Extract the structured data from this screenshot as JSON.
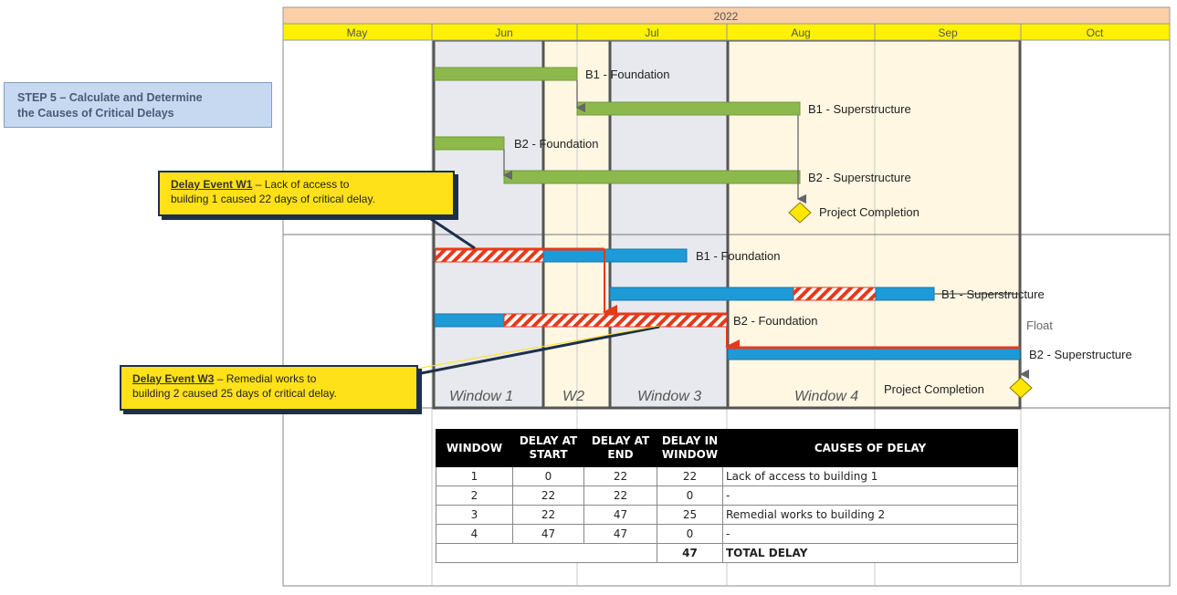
{
  "timeline": {
    "year": "2022",
    "months": [
      "May",
      "Jun",
      "Jul",
      "Aug",
      "Sep",
      "Oct"
    ]
  },
  "step_box": {
    "line1": "STEP 5 – Calculate and Determine",
    "line2": "the Causes of Critical Delays"
  },
  "planned_activities": {
    "b1_foundation": "B1 - Foundation",
    "b1_superstructure": "B1 - Superstructure",
    "b2_foundation": "B2 - Foundation",
    "b2_superstructure": "B2 - Superstructure",
    "completion": "Project Completion"
  },
  "asbuilt_activities": {
    "b1_foundation": "B1 - Foundation",
    "b1_superstructure": "B1 - Superstructure",
    "b2_foundation": "B2 - Foundation",
    "b2_superstructure": "B2 - Superstructure",
    "float": "Float",
    "completion": "Project Completion"
  },
  "windows": [
    "Window 1",
    "W2",
    "Window 3",
    "Window 4"
  ],
  "callouts": {
    "w1": {
      "event": "Delay Event W1",
      "text1": " – Lack of access to",
      "text2": "building 1 caused 22 days of critical delay."
    },
    "w3": {
      "event": "Delay Event W3",
      "text1": " – Remedial works to",
      "text2": "building 2 caused 25 days of critical delay."
    }
  },
  "delay_table": {
    "headers": {
      "window": "WINDOW",
      "start_1": "DELAY AT",
      "start_2": "START",
      "end_1": "DELAY AT",
      "end_2": "END",
      "in_1": "DELAY IN",
      "in_2": "WINDOW",
      "causes": "CAUSES OF DELAY"
    },
    "rows": [
      {
        "window": "1",
        "start": "0",
        "end": "22",
        "in_window": "22",
        "cause": "Lack of access to building 1"
      },
      {
        "window": "2",
        "start": "22",
        "end": "22",
        "in_window": "0",
        "cause": "-"
      },
      {
        "window": "3",
        "start": "22",
        "end": "47",
        "in_window": "25",
        "cause": "Remedial works to building 2"
      },
      {
        "window": "4",
        "start": "47",
        "end": "47",
        "in_window": "0",
        "cause": "-"
      }
    ],
    "total": {
      "value": "47",
      "label": "TOTAL DELAY"
    }
  },
  "colors": {
    "year_header": "#fbcfa8",
    "month_header": "#fff100",
    "planned_bar": "#8db94c",
    "asbuilt_bar": "#1e9ad6",
    "delay_hatch": "#e8381a",
    "window_shade_grey": "#e7e9ee",
    "window_shade_cream": "#fff7e2",
    "milestone": "#ffe600",
    "callout_fill": "#ffe11a",
    "step_fill": "#c6d9f1",
    "table_header": "#000000"
  }
}
